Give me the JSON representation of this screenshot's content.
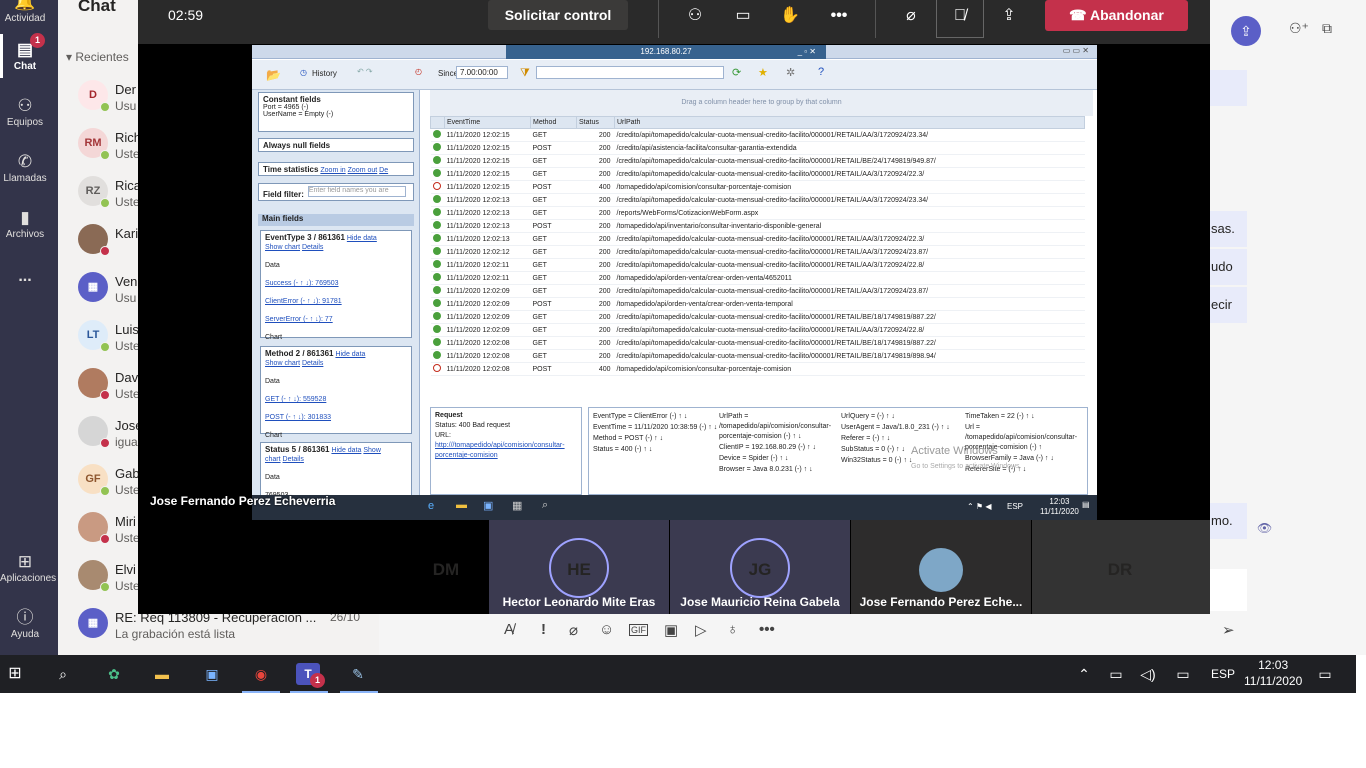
{
  "rail": {
    "items": [
      {
        "label": "Actividad",
        "icon": "bell-icon"
      },
      {
        "label": "Chat",
        "icon": "chat-icon",
        "badge": "1"
      },
      {
        "label": "Equipos",
        "icon": "teams-icon"
      },
      {
        "label": "Llamadas",
        "icon": "phone-icon"
      },
      {
        "label": "Archivos",
        "icon": "files-icon"
      },
      {
        "label": "...",
        "icon": "more-icon"
      },
      {
        "label": "Aplicaciones",
        "icon": "apps-icon"
      },
      {
        "label": "Ayuda",
        "icon": "help-icon"
      }
    ]
  },
  "chat": {
    "title": "Chat",
    "section": "Recientes",
    "items": [
      {
        "initials": "D",
        "name": "Der",
        "preview": "Usu",
        "date": "",
        "bg": "#fde7e9",
        "fg": "#a4262c",
        "status": "#92c353"
      },
      {
        "initials": "RM",
        "name": "Rich",
        "preview": "Uste",
        "date": "",
        "bg": "#f4d7d7",
        "fg": "#a4373a",
        "status": "#92c353"
      },
      {
        "initials": "RZ",
        "name": "Rica",
        "preview": "Uste",
        "date": "",
        "bg": "#e1dfdd",
        "fg": "#605e5c",
        "status": "#92c353"
      },
      {
        "initials": "",
        "name": "Kari",
        "preview": "",
        "date": "",
        "bg": "#8a6a55",
        "fg": "#fff",
        "status": "#c4314b"
      },
      {
        "initials": "▦",
        "name": "Ven",
        "preview": "Usu",
        "date": "",
        "bg": "#5b5fc7",
        "fg": "#fff",
        "status": ""
      },
      {
        "initials": "LT",
        "name": "Luis",
        "preview": "Uste",
        "date": "",
        "bg": "#deecf9",
        "fg": "#2b579a",
        "status": "#92c353"
      },
      {
        "initials": "",
        "name": "Dav",
        "preview": "Uste",
        "date": "",
        "bg": "#b07b60",
        "fg": "#fff",
        "status": "#c4314b"
      },
      {
        "initials": "",
        "name": "Jose",
        "preview": "igua",
        "date": "",
        "bg": "#d6d6d6",
        "fg": "#fff",
        "status": "#c4314b"
      },
      {
        "initials": "GF",
        "name": "Gab",
        "preview": "Uste",
        "date": "",
        "bg": "#f8e0c4",
        "fg": "#8e562e",
        "status": "#92c353"
      },
      {
        "initials": "",
        "name": "Miri",
        "preview": "Uste",
        "date": "",
        "bg": "#c99a82",
        "fg": "#fff",
        "status": "#c4314b"
      },
      {
        "initials": "",
        "name": "Elvi",
        "preview": "Uste",
        "date": "",
        "bg": "#a88a70",
        "fg": "#fff",
        "status": "#92c353"
      },
      {
        "initials": "▦",
        "name": "RE: Req 113809 - Recuperacion ...",
        "preview": "La grabación está lista",
        "date": "26/10",
        "bg": "#5b5fc7",
        "fg": "#fff",
        "status": ""
      }
    ]
  },
  "main": {
    "messages": [
      {
        "text": ""
      },
      {
        "text": "sas."
      },
      {
        "text": "udo"
      },
      {
        "text": "ecir"
      },
      {
        "text": "mo."
      }
    ]
  },
  "meeting": {
    "timer": "02:59",
    "control_label": "Solicitar control",
    "leave_label": "Abandonar",
    "presenter": "Jose Fernando Perez Echeverria",
    "participants": [
      {
        "initials": "DM",
        "name": "",
        "bg": "#f6e3b4",
        "fg": "#8a5a00"
      },
      {
        "initials": "HE",
        "name": "Hector Leonardo Mite Eras",
        "bg": "#f8d7d3",
        "fg": "#a4373a"
      },
      {
        "initials": "JG",
        "name": "Jose Mauricio Reina Gabela",
        "bg": "#e8e3d8",
        "fg": "#6d5a3c"
      },
      {
        "initials": "",
        "name": "Jose Fernando Perez Eche...",
        "bg": "#7ea7c7",
        "fg": "#fff"
      },
      {
        "initials": "DR",
        "name": "",
        "bg": "#d5efe6",
        "fg": "#1e6e52"
      }
    ]
  },
  "shared": {
    "window_title": "192.168.80.27",
    "toolbar": {
      "history": "History",
      "since_label": "Since",
      "since_value": "7.00:00:00"
    },
    "left": {
      "constant_fields": "Constant fields",
      "port": "Port = 4965 (-)",
      "username": "UserName = Empty (-)",
      "always_null": "Always null fields",
      "time_stats": "Time statistics",
      "zoom_in": "Zoom in",
      "zoom_out": "Zoom out",
      "de": "De",
      "field_filter": "Field filter:",
      "filter_placeholder": "Enter field names you are",
      "main_fields": "Main fields",
      "eventtype": "EventType 3 / 861361",
      "hide_data": "Hide data",
      "show_chart": "Show chart",
      "details": "Details",
      "data": "Data",
      "success": "Success (-  ↑ ↓): 769503",
      "clienterror": "ClientError (-  ↑ ↓): 91781",
      "servererror": "ServerError (-  ↑ ↓): 77",
      "chart": "Chart",
      "method": "Method 2 / 861361",
      "get": "GET (-  ↑ ↓): 559528",
      "post": "POST (-  ↑ ↓): 301833",
      "status": "Status 5 / 861361",
      "show": "Show",
      "chart_lbl": "chart",
      "status_val": "769503"
    },
    "grid": {
      "group_hint": "Drag a column header here to group by that column",
      "headers": [
        "",
        "EventTime",
        "Method",
        "Status",
        "UrlPath"
      ],
      "rows": [
        [
          "ok",
          "11/11/2020 12:02:15",
          "GET",
          "200",
          "/credito/api/tomapedido/calcular-cuota-mensual-credito-facilito/000001/RETAIL/AA/3/1720924/23.34/"
        ],
        [
          "ok",
          "11/11/2020 12:02:15",
          "POST",
          "200",
          "/credito/api/asistencia-facilita/consultar-garantia-extendida"
        ],
        [
          "ok",
          "11/11/2020 12:02:15",
          "GET",
          "200",
          "/credito/api/tomapedido/calcular-cuota-mensual-credito-facilito/000001/RETAIL/BE/24/1749819/949.87/"
        ],
        [
          "ok",
          "11/11/2020 12:02:15",
          "GET",
          "200",
          "/credito/api/tomapedido/calcular-cuota-mensual-credito-facilito/000001/RETAIL/AA/3/1720924/22.3/"
        ],
        [
          "err",
          "11/11/2020 12:02:15",
          "POST",
          "400",
          "/tomapedido/api/comision/consultar-porcentaje-comision"
        ],
        [
          "ok",
          "11/11/2020 12:02:13",
          "GET",
          "200",
          "/credito/api/tomapedido/calcular-cuota-mensual-credito-facilito/000001/RETAIL/AA/3/1720924/23.34/"
        ],
        [
          "ok",
          "11/11/2020 12:02:13",
          "GET",
          "200",
          "/reports/WebForms/CotizacionWebForm.aspx"
        ],
        [
          "ok",
          "11/11/2020 12:02:13",
          "POST",
          "200",
          "/tomapedido/api/inventario/consultar-inventario-disponible-general"
        ],
        [
          "ok",
          "11/11/2020 12:02:13",
          "GET",
          "200",
          "/credito/api/tomapedido/calcular-cuota-mensual-credito-facilito/000001/RETAIL/AA/3/1720924/22.3/"
        ],
        [
          "ok",
          "11/11/2020 12:02:12",
          "GET",
          "200",
          "/credito/api/tomapedido/calcular-cuota-mensual-credito-facilito/000001/RETAIL/AA/3/1720924/23.87/"
        ],
        [
          "ok",
          "11/11/2020 12:02:11",
          "GET",
          "200",
          "/credito/api/tomapedido/calcular-cuota-mensual-credito-facilito/000001/RETAIL/AA/3/1720924/22.8/"
        ],
        [
          "ok",
          "11/11/2020 12:02:11",
          "GET",
          "200",
          "/tomapedido/api/orden-venta/crear-orden-venta/4652011"
        ],
        [
          "ok",
          "11/11/2020 12:02:09",
          "GET",
          "200",
          "/credito/api/tomapedido/calcular-cuota-mensual-credito-facilito/000001/RETAIL/AA/3/1720924/23.87/"
        ],
        [
          "ok",
          "11/11/2020 12:02:09",
          "POST",
          "200",
          "/tomapedido/api/orden-venta/crear-orden-venta-temporal"
        ],
        [
          "ok",
          "11/11/2020 12:02:09",
          "GET",
          "200",
          "/credito/api/tomapedido/calcular-cuota-mensual-credito-facilito/000001/RETAIL/BE/18/1749819/887.22/"
        ],
        [
          "ok",
          "11/11/2020 12:02:09",
          "GET",
          "200",
          "/credito/api/tomapedido/calcular-cuota-mensual-credito-facilito/000001/RETAIL/AA/3/1720924/22.8/"
        ],
        [
          "ok",
          "11/11/2020 12:02:08",
          "GET",
          "200",
          "/credito/api/tomapedido/calcular-cuota-mensual-credito-facilito/000001/RETAIL/BE/18/1749819/887.22/"
        ],
        [
          "ok",
          "11/11/2020 12:02:08",
          "GET",
          "200",
          "/credito/api/tomapedido/calcular-cuota-mensual-credito-facilito/000001/RETAIL/BE/18/1749819/898.94/"
        ],
        [
          "err",
          "11/11/2020 12:02:08",
          "POST",
          "400",
          "/tomapedido/api/comision/consultar-porcentaje-comision"
        ]
      ]
    },
    "detail": {
      "request_title": "Request",
      "request_status": "Status: 400 Bad request",
      "request_url_label": "URL:",
      "request_url": "http:///tomapedido/api/comision/consultar-porcentaje-comision",
      "col1": [
        "EventType = ClientError (-) ↑ ↓",
        "EventTime = 11/11/2020 10:38:59 (-) ↑ ↓",
        "Method = POST (-) ↑ ↓",
        "Status = 400 (-) ↑ ↓"
      ],
      "col2": [
        "UrlPath = /tomapedido/api/comision/consultar-porcentaje-comision (-) ↑ ↓",
        "ClientIP = 192.168.80.29 (-) ↑ ↓",
        "Device = Spider (-) ↑ ↓",
        "Browser = Java 8.0.231 (-) ↑ ↓"
      ],
      "col3": [
        "UrlQuery = (-) ↑ ↓",
        "UserAgent = Java/1.8.0_231 (-) ↑ ↓",
        "Referer = (-) ↑ ↓",
        "SubStatus = 0 (-) ↑ ↓",
        "Win32Status = 0 (-) ↑ ↓"
      ],
      "col4": [
        "TimeTaken = 22 (-) ↑ ↓",
        "Url = /tomapedido/api/comision/consultar-porcentaje-comision (-) ↑",
        "BrowserFamily = Java (-) ↑ ↓",
        "RefererSite = (-) ↑ ↓"
      ],
      "activate": "Activate Windows",
      "activate_sub": "Go to Settings to activate Windows."
    },
    "taskbar": {
      "lang": "ESP",
      "time": "12:03",
      "date": "11/11/2020"
    }
  },
  "taskbar": {
    "lang": "ESP",
    "time": "12:03",
    "date": "11/11/2020",
    "teams_badge": "1"
  }
}
